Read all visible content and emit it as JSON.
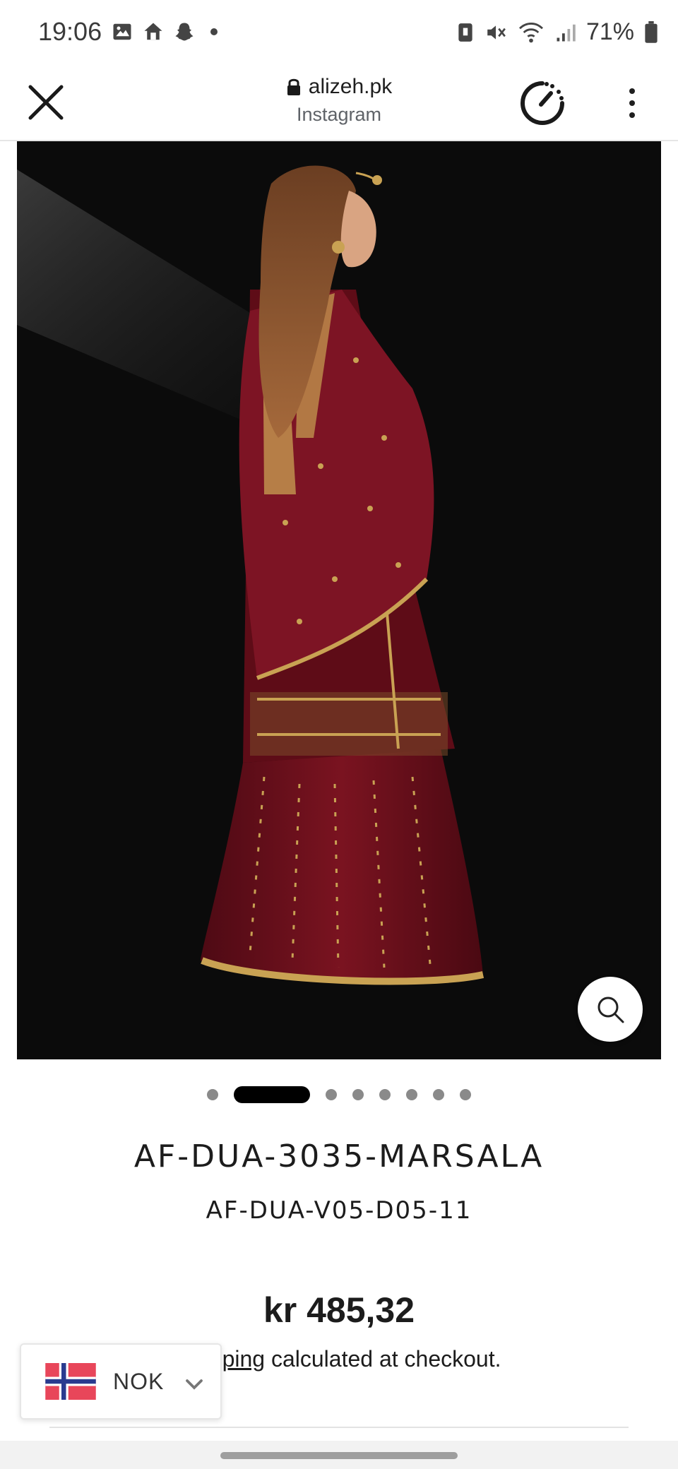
{
  "status_bar": {
    "time": "19:06",
    "battery": "71%",
    "left_icons": [
      "gallery-icon",
      "home-assistant-icon",
      "snapchat-icon",
      "notification-dot"
    ],
    "right_icons": [
      "nfc-icon",
      "mute-icon",
      "wifi-icon",
      "signal-icon",
      "battery-icon"
    ]
  },
  "browser": {
    "domain": "alizeh.pk",
    "source": "Instagram",
    "close_icon": "close-icon",
    "speed_icon": "page-speed-icon",
    "menu_icon": "more-vert-icon"
  },
  "product": {
    "image_alt": "Model wearing maroon embroidered outfit with dupatta",
    "zoom_icon": "search-icon",
    "carousel": {
      "count": 8,
      "active_index": 1
    },
    "title": "AF-DUA-3035-MARSALA",
    "sku": "AF-DUA-V05-D05-11",
    "price": "kr 485,32",
    "shipping_link": "Shipping",
    "shipping_rest": " calculated at checkout."
  },
  "currency_selector": {
    "code": "NOK",
    "flag": "norway-flag-icon",
    "chevron": "chevron-down-icon"
  },
  "colors": {
    "accent": "#000000",
    "dress": "#6b0f1a",
    "gold": "#c9a253",
    "background": "#0b0b0b"
  }
}
